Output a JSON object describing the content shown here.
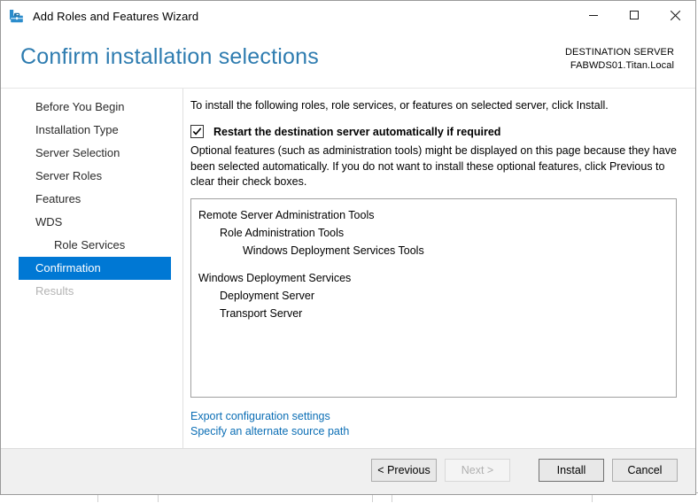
{
  "window": {
    "title": "Add Roles and Features Wizard",
    "icon": "wizard-toolbox-icon",
    "controls": {
      "minimize": "minimize-icon",
      "maximize": "maximize-icon",
      "close": "close-icon"
    }
  },
  "header": {
    "page_title": "Confirm installation selections",
    "destination_label": "DESTINATION SERVER",
    "destination_value": "FABWDS01.Titan.Local",
    "title_color": "#2e7cb0"
  },
  "nav": {
    "items": [
      {
        "label": "Before You Begin",
        "state": "normal",
        "indent": false
      },
      {
        "label": "Installation Type",
        "state": "normal",
        "indent": false
      },
      {
        "label": "Server Selection",
        "state": "normal",
        "indent": false
      },
      {
        "label": "Server Roles",
        "state": "normal",
        "indent": false
      },
      {
        "label": "Features",
        "state": "normal",
        "indent": false
      },
      {
        "label": "WDS",
        "state": "normal",
        "indent": false
      },
      {
        "label": "Role Services",
        "state": "normal",
        "indent": true
      },
      {
        "label": "Confirmation",
        "state": "selected",
        "indent": false
      },
      {
        "label": "Results",
        "state": "disabled",
        "indent": false
      }
    ],
    "selected_color": "#0078d4"
  },
  "main": {
    "intro": "To install the following roles, role services, or features on selected server, click Install.",
    "restart_checkbox": {
      "label": "Restart the destination server automatically if required",
      "checked": true
    },
    "optional_note": "Optional features (such as administration tools) might be displayed on this page because they have been selected automatically. If you do not want to install these optional features, click Previous to clear their check boxes.",
    "selections": [
      {
        "text": "Remote Server Administration Tools",
        "level": 0,
        "gap_before": false
      },
      {
        "text": "Role Administration Tools",
        "level": 1,
        "gap_before": false
      },
      {
        "text": "Windows Deployment Services Tools",
        "level": 2,
        "gap_before": false
      },
      {
        "text": "Windows Deployment Services",
        "level": 0,
        "gap_before": true
      },
      {
        "text": "Deployment Server",
        "level": 1,
        "gap_before": false
      },
      {
        "text": "Transport Server",
        "level": 1,
        "gap_before": false
      }
    ],
    "links": [
      {
        "label": "Export configuration settings"
      },
      {
        "label": "Specify an alternate source path"
      }
    ],
    "link_color": "#0b6eb5"
  },
  "footer": {
    "previous": "< Previous",
    "next": "Next >",
    "install": "Install",
    "cancel": "Cancel",
    "next_enabled": false,
    "install_is_default": true
  }
}
